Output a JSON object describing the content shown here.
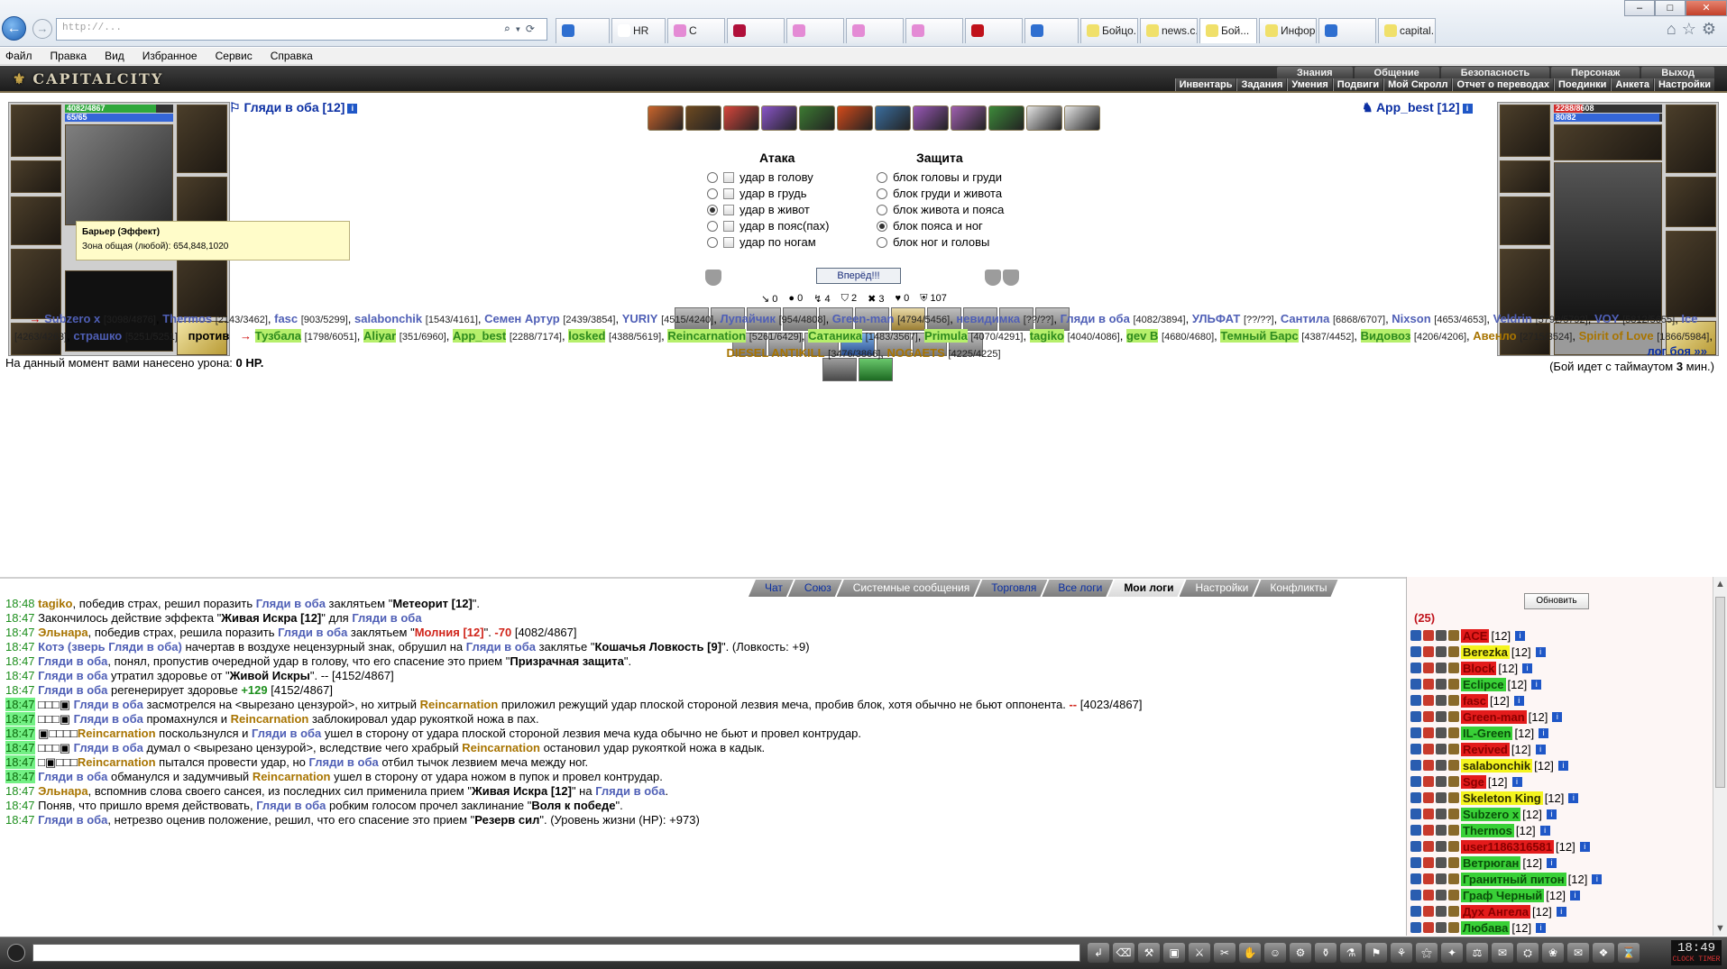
{
  "browser": {
    "address": "http://...",
    "tabs": [
      {
        "label": "",
        "color": "#2f6fd0"
      },
      {
        "label": "HR",
        "color": "#ffffff"
      },
      {
        "label": "C",
        "color": "#e48bd5"
      },
      {
        "label": "",
        "color": "#b0103a"
      },
      {
        "label": "",
        "color": "#e48bd5"
      },
      {
        "label": "",
        "color": "#e48bd5"
      },
      {
        "label": "",
        "color": "#e48bd5"
      },
      {
        "label": "",
        "color": "#c0121b"
      },
      {
        "label": "",
        "color": "#2f6fd0"
      },
      {
        "label": "Бойцо...",
        "color": "#f0e06a"
      },
      {
        "label": "news.c...",
        "color": "#f0e06a"
      },
      {
        "label": "Бой...",
        "color": "#f0e06a"
      },
      {
        "label": "Инфор...",
        "color": "#f0e06a"
      },
      {
        "label": "",
        "color": "#2f6fd0"
      },
      {
        "label": "capital...",
        "color": "#f0e06a"
      }
    ],
    "menu": [
      "Файл",
      "Правка",
      "Вид",
      "Избранное",
      "Сервис",
      "Справка"
    ]
  },
  "game": {
    "logo": "CAPITALCITY",
    "topnav": [
      "Знания",
      "Общение",
      "Безопасность",
      "Персонаж",
      "Выход"
    ],
    "subnav": [
      "Инвентарь",
      "Задания",
      "Умения",
      "Подвиги",
      "Мой Скролл",
      "Отчет о переводах",
      "Поединки",
      "Анкета",
      "Настройки"
    ]
  },
  "player": {
    "name": "Гляди в оба [12]",
    "hp": "4082/4867",
    "hp_fraction": 0.8387,
    "mana": "65/65",
    "mana_fraction": 1.0
  },
  "opponent": {
    "name": "App_best [12]",
    "hp": "2288/8608",
    "hp_fraction": 0.2658,
    "mana": "80/82",
    "mana_fraction": 0.9756
  },
  "tooltip": {
    "title": "Барьер (Эффект)",
    "text": "Зона общая (любой): 654,848,1020"
  },
  "attack": {
    "header": "Атака",
    "options": [
      "удар в голову",
      "удар в грудь",
      "удар в живот",
      "удар в пояс(пах)",
      "удар по ногам"
    ],
    "selected": 2
  },
  "defense": {
    "header": "Защита",
    "options": [
      "блок головы и груди",
      "блок груди и живота",
      "блок живота и пояса",
      "блок пояса и ног",
      "блок ног и головы"
    ],
    "selected": 3
  },
  "go_button": "Вперёд!!!",
  "stats": [
    "0",
    "0",
    "4",
    "2",
    "3",
    "0",
    "107"
  ],
  "team1": [
    {
      "name": "Subzero x",
      "hp": "[3098/4876]"
    },
    {
      "name": "Thermos",
      "hp": "[2143/3462]"
    },
    {
      "name": "fasc",
      "hp": "[903/5299]"
    },
    {
      "name": "salabonchik",
      "hp": "[1543/4161]"
    },
    {
      "name": "Семен Артур",
      "hp": "[2439/3854]"
    },
    {
      "name": "YURIY",
      "hp": "[4515/4240]"
    },
    {
      "name": "Лупайчик",
      "hp": "[954/4808]"
    },
    {
      "name": "Green-man",
      "hp": "[4794/5456]"
    },
    {
      "name": "невидимка",
      "hp": "[??/??]"
    },
    {
      "name": "Гляди в оба",
      "hp": "[4082/3894]"
    },
    {
      "name": "УЛЬФАТ",
      "hp": "[??/??]"
    },
    {
      "name": "Сантила",
      "hp": "[6868/6707]"
    },
    {
      "name": "Nixson",
      "hp": "[4653/4653]"
    },
    {
      "name": "Veldrin",
      "hp": "[5792/5792]"
    },
    {
      "name": "VOY",
      "hp": "[5812/5655]"
    },
    {
      "name": "Ice",
      "hp": "[4263/4263]"
    },
    {
      "name": "страшко",
      "hp": "[5251/5251]"
    }
  ],
  "vs": "против",
  "team2": [
    {
      "name": "Тузбала",
      "hp": "[1798/6051]",
      "hl": true
    },
    {
      "name": "Aliyar",
      "hp": "[351/6960]",
      "hl": true
    },
    {
      "name": "App_best",
      "hp": "[2288/7174]",
      "hl": true
    },
    {
      "name": "losked",
      "hp": "[4388/5619]",
      "hl": true
    },
    {
      "name": "Reincarnation",
      "hp": "[5261/6429]",
      "hl": true
    },
    {
      "name": "Сатаника",
      "hp": "[1483/3567]",
      "hl": true
    },
    {
      "name": "Primula",
      "hp": "[4070/4291]",
      "hl": true
    },
    {
      "name": "tagiko",
      "hp": "[4040/4086]",
      "hl": true
    },
    {
      "name": "gev B",
      "hp": "[4680/4680]",
      "hl": true
    },
    {
      "name": "Темный Барс",
      "hp": "[4387/4452]",
      "hl": true
    },
    {
      "name": "Видовоз",
      "hp": "[4206/4206]",
      "hl": true
    },
    {
      "name": "Авенло",
      "hp": "[2715/3524]",
      "hl": false
    },
    {
      "name": "Spirit of Love",
      "hp": "[1866/5984]",
      "hl": false
    },
    {
      "name": "DIESEL ANTIKILL",
      "hp": "[3476/3866]",
      "hl": false
    },
    {
      "name": "NOGAETS",
      "hp": "[4225/4225]",
      "hl": false
    }
  ],
  "damage_label": "На данный момент вами нанесено урона:",
  "damage_value": "0 HP.",
  "log_link": "лог боя »»",
  "timeout_text": "(Бой идет с таймаутом",
  "timeout_value": "3",
  "timeout_unit": "мин.)",
  "chat_tabs": [
    {
      "label": "Чат",
      "type": "link"
    },
    {
      "label": "Союз",
      "type": "link"
    },
    {
      "label": "Системные сообщения",
      "type": "plain"
    },
    {
      "label": "Торговля",
      "type": "link"
    },
    {
      "label": "Все логи",
      "type": "link"
    },
    {
      "label": "Мои логи",
      "type": "sel"
    },
    {
      "label": "Настройки",
      "type": "plain"
    },
    {
      "label": "Конфликты",
      "type": "plain"
    }
  ],
  "chat": [
    {
      "t": "18:48",
      "hl": false,
      "parts": [
        [
          "nm2",
          "tagiko"
        ],
        [
          "",
          ", победив страх, решил поразить "
        ],
        [
          "nm",
          "Гляди в оба"
        ],
        [
          "",
          " заклятьем \""
        ],
        [
          "sp",
          "Метеорит [12]"
        ],
        [
          "",
          "\"."
        ]
      ]
    },
    {
      "t": "18:47",
      "hl": false,
      "parts": [
        [
          "",
          "Закончилось действие эффекта \""
        ],
        [
          "sp",
          "Живая Искра [12]"
        ],
        [
          "",
          "\" для "
        ],
        [
          "nm",
          "Гляди в оба"
        ]
      ]
    },
    {
      "t": "18:47",
      "hl": false,
      "parts": [
        [
          "nm2",
          "Эльнара"
        ],
        [
          "",
          ", победив страх, решила поразить "
        ],
        [
          "nm",
          "Гляди в оба"
        ],
        [
          "",
          " заклятьем \""
        ],
        [
          "red",
          "Молния [12]"
        ],
        [
          "",
          "\". "
        ],
        [
          "red",
          "-70"
        ],
        [
          "",
          " [4082/4867]"
        ]
      ]
    },
    {
      "t": "18:47",
      "hl": false,
      "parts": [
        [
          "nm",
          "Котэ (зверь Гляди в оба)"
        ],
        [
          "",
          " начертав в воздухе нецензурный знак, обрушил на "
        ],
        [
          "nm",
          "Гляди в оба"
        ],
        [
          "",
          " заклятье \""
        ],
        [
          "sp",
          "Кошачья Ловкость [9]"
        ],
        [
          "",
          "\". (Ловкость: +9)"
        ]
      ]
    },
    {
      "t": "18:47",
      "hl": false,
      "parts": [
        [
          "nm",
          "Гляди в оба"
        ],
        [
          "",
          ", понял, пропустив очередной удар в голову, что его спасение это прием \""
        ],
        [
          "sp",
          "Призрачная защита"
        ],
        [
          "",
          "\"."
        ]
      ]
    },
    {
      "t": "18:47",
      "hl": false,
      "parts": [
        [
          "nm",
          "Гляди в оба"
        ],
        [
          "",
          " утратил здоровье от \""
        ],
        [
          "sp",
          "Живой Искры"
        ],
        [
          "",
          "\". -- [4152/4867]"
        ]
      ]
    },
    {
      "t": "18:47",
      "hl": false,
      "parts": [
        [
          "nm",
          "Гляди в оба"
        ],
        [
          "",
          " регенерирует здоровье "
        ],
        [
          "grn",
          "+129"
        ],
        [
          "",
          " [4152/4867]"
        ]
      ]
    },
    {
      "t": "18:47",
      "hl": true,
      "parts": [
        [
          "",
          "□□□▣ "
        ],
        [
          "nm",
          "Гляди в оба"
        ],
        [
          "",
          " засмотрелся на <вырезано цензурой>, но хитрый "
        ],
        [
          "nm2",
          "Reincarnation"
        ],
        [
          "",
          " приложил режущий удар плоской стороной лезвия меча, пробив блок, хотя обычно не бьют оппонента. "
        ],
        [
          "red",
          "--"
        ],
        [
          "",
          " [4023/4867]"
        ]
      ]
    },
    {
      "t": "18:47",
      "hl": true,
      "parts": [
        [
          "",
          "□□□▣ "
        ],
        [
          "nm",
          "Гляди в оба"
        ],
        [
          "",
          " промахнулся и "
        ],
        [
          "nm2",
          "Reincarnation"
        ],
        [
          "",
          " заблокировал удар рукояткой ножа в пах."
        ]
      ]
    },
    {
      "t": "18:47",
      "hl": true,
      "parts": [
        [
          "",
          "▣□□□□"
        ],
        [
          "nm2",
          "Reincarnation"
        ],
        [
          "",
          " поскользнулся и "
        ],
        [
          "nm",
          "Гляди в оба"
        ],
        [
          "",
          " ушел в сторону от удара плоской стороной лезвия меча куда обычно не бьют и провел контрудар."
        ]
      ]
    },
    {
      "t": "18:47",
      "hl": true,
      "parts": [
        [
          "",
          "□□□▣ "
        ],
        [
          "nm",
          "Гляди в оба"
        ],
        [
          "",
          " думал о <вырезано цензурой>, вследствие чего храбрый "
        ],
        [
          "nm2",
          "Reincarnation"
        ],
        [
          "",
          " остановил удар рукояткой ножа в кадык."
        ]
      ]
    },
    {
      "t": "18:47",
      "hl": true,
      "parts": [
        [
          "",
          "□▣□□□"
        ],
        [
          "nm2",
          "Reincarnation"
        ],
        [
          "",
          " пытался провести удар, но "
        ],
        [
          "nm",
          "Гляди в оба"
        ],
        [
          "",
          " отбил тычок лезвием меча между ног."
        ]
      ]
    },
    {
      "t": "18:47",
      "hl": true,
      "parts": [
        [
          "",
          "          "
        ],
        [
          "nm",
          "Гляди в оба"
        ],
        [
          "",
          " обманулся и задумчивый "
        ],
        [
          "nm2",
          "Reincarnation"
        ],
        [
          "",
          " ушел в сторону от удара ножом в пупок и провел контрудар."
        ]
      ]
    },
    {
      "t": "18:47",
      "hl": false,
      "parts": [
        [
          "nm2",
          "Эльнара"
        ],
        [
          "",
          ", вспомнив слова своего сансея, из последних сил применила прием \""
        ],
        [
          "sp",
          "Живая Искра [12]"
        ],
        [
          "",
          "\" на "
        ],
        [
          "nm",
          "Гляди в оба"
        ],
        [
          "",
          "."
        ]
      ]
    },
    {
      "t": "18:47",
      "hl": false,
      "parts": [
        [
          "",
          "Поняв, что пришло время действовать, "
        ],
        [
          "nm",
          "Гляди в оба"
        ],
        [
          "",
          " робким голосом прочел заклинание \""
        ],
        [
          "sp",
          "Воля к победе"
        ],
        [
          "",
          "\"."
        ]
      ]
    },
    {
      "t": "18:47",
      "hl": false,
      "parts": [
        [
          "nm",
          "Гляди в оба"
        ],
        [
          "",
          ", нетрезво оценив положение, решил, что его спасение это прием \""
        ],
        [
          "sp",
          "Резерв сил"
        ],
        [
          "",
          "\". (Уровень жизни (HP): +973)"
        ]
      ]
    }
  ],
  "sidebar": {
    "refresh": "Обновить",
    "count": "(25)",
    "players": [
      {
        "name": "ACE",
        "style": "red",
        "lvl": "[12]"
      },
      {
        "name": "Berezka",
        "style": "yel",
        "lvl": "[12]"
      },
      {
        "name": "Block",
        "style": "red",
        "lvl": "[12]"
      },
      {
        "name": "Eclipce",
        "style": "grn",
        "lvl": "[12]"
      },
      {
        "name": "fasc",
        "style": "red",
        "lvl": "[12]"
      },
      {
        "name": "Green-man",
        "style": "red",
        "lvl": "[12]"
      },
      {
        "name": "IL-Green",
        "style": "grn",
        "lvl": "[12]"
      },
      {
        "name": "Revived",
        "style": "red",
        "lvl": "[12]"
      },
      {
        "name": "salabonchik",
        "style": "yel",
        "lvl": "[12]"
      },
      {
        "name": "Sge",
        "style": "red",
        "lvl": "[12]"
      },
      {
        "name": "Skeleton King",
        "style": "yel",
        "lvl": "[12]"
      },
      {
        "name": "Subzero x",
        "style": "grn",
        "lvl": "[12]"
      },
      {
        "name": "Thermos",
        "style": "grn",
        "lvl": "[12]"
      },
      {
        "name": "user1186316581",
        "style": "red",
        "lvl": "[12]"
      },
      {
        "name": "Ветрюган",
        "style": "grn",
        "lvl": "[12]"
      },
      {
        "name": "Гранитный питон",
        "style": "grn",
        "lvl": "[12]"
      },
      {
        "name": "Граф Черный",
        "style": "grn",
        "lvl": "[12]"
      },
      {
        "name": "Дух Ангела",
        "style": "red",
        "lvl": "[12]"
      },
      {
        "name": "Любава",
        "style": "grn",
        "lvl": "[12]"
      }
    ]
  },
  "clock": {
    "time": "18:49",
    "label": "CLOCK TIMER"
  }
}
